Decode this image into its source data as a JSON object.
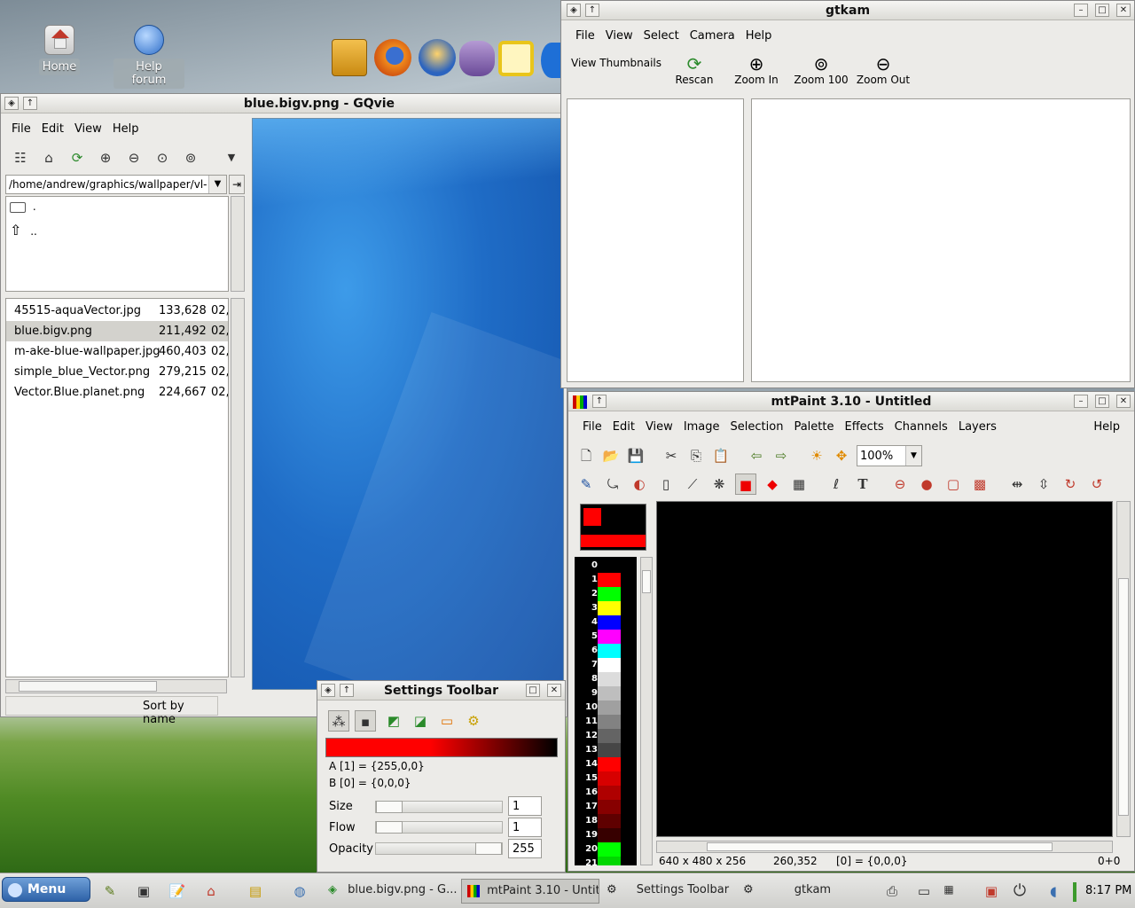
{
  "desktop": {
    "icons": [
      {
        "label": "Home"
      },
      {
        "label": "Help forum"
      }
    ]
  },
  "gqview": {
    "title": "blue.bigv.png - GQvie",
    "menu": [
      "File",
      "Edit",
      "View",
      "Help"
    ],
    "path": "/home/andrew/graphics/wallpaper/vl-",
    "dirs": [
      ".",
      ".."
    ],
    "files": [
      {
        "name": "45515-aquaVector.jpg",
        "size": "133,628",
        "date": "02,"
      },
      {
        "name": "blue.bigv.png",
        "size": "211,492",
        "date": "02,"
      },
      {
        "name": "m-ake-blue-wallpaper.jpg",
        "size": "460,403",
        "date": "02,"
      },
      {
        "name": "simple_blue_Vector.png",
        "size": "279,215",
        "date": "02,"
      },
      {
        "name": "Vector.Blue.planet.png",
        "size": "224,667",
        "date": "02,"
      }
    ],
    "sort_label": "Sort by name"
  },
  "gtkam": {
    "title": "gtkam",
    "menu": [
      "File",
      "View",
      "Select",
      "Camera",
      "Help"
    ],
    "view_thumbnails": "View Thumbnails",
    "tools": [
      "Rescan",
      "Zoom In",
      "Zoom 100",
      "Zoom Out"
    ]
  },
  "mtpaint": {
    "title": "mtPaint 3.10 - Untitled",
    "menu": [
      "File",
      "Edit",
      "View",
      "Image",
      "Selection",
      "Palette",
      "Effects",
      "Channels",
      "Layers"
    ],
    "help": "Help",
    "zoom": "100%",
    "palette": [
      {
        "n": "0",
        "c": "#000000"
      },
      {
        "n": "1",
        "c": "#ff0000"
      },
      {
        "n": "2",
        "c": "#00ff00"
      },
      {
        "n": "3",
        "c": "#ffff00"
      },
      {
        "n": "4",
        "c": "#0000ff"
      },
      {
        "n": "5",
        "c": "#ff00ff"
      },
      {
        "n": "6",
        "c": "#00ffff"
      },
      {
        "n": "7",
        "c": "#ffffff"
      },
      {
        "n": "8",
        "c": "#dcdcdc"
      },
      {
        "n": "9",
        "c": "#bebebe"
      },
      {
        "n": "10",
        "c": "#a0a0a0"
      },
      {
        "n": "11",
        "c": "#828282"
      },
      {
        "n": "12",
        "c": "#646464"
      },
      {
        "n": "13",
        "c": "#464646"
      },
      {
        "n": "14",
        "c": "#ff0000"
      },
      {
        "n": "15",
        "c": "#d70000"
      },
      {
        "n": "16",
        "c": "#af0000"
      },
      {
        "n": "17",
        "c": "#870000"
      },
      {
        "n": "18",
        "c": "#5f0000"
      },
      {
        "n": "19",
        "c": "#370000"
      },
      {
        "n": "20",
        "c": "#00ff00"
      },
      {
        "n": "21",
        "c": "#00d700"
      }
    ],
    "status_size": "640 x 480 x 256",
    "status_pos": "260,352",
    "status_col": "[0] = {0,0,0}",
    "status_right": "0+0"
  },
  "settings": {
    "title": "Settings Toolbar",
    "a_label": "A [1] = {255,0,0}",
    "b_label": "B [0] = {0,0,0}",
    "rows": [
      {
        "label": "Size",
        "value": "1"
      },
      {
        "label": "Flow",
        "value": "1"
      },
      {
        "label": "Opacity",
        "value": "255"
      }
    ]
  },
  "taskbar": {
    "menu": "Menu",
    "tasks": [
      "blue.bigv.png - G...",
      "mtPaint 3.10 - Untit...",
      "Settings Toolbar",
      "gtkam"
    ],
    "clock": "8:17 PM"
  }
}
